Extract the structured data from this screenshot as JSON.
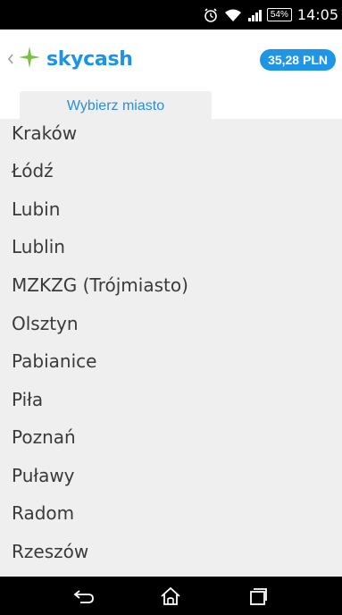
{
  "status_bar": {
    "battery": "54%",
    "time": "14:05",
    "icons": [
      "alarm-icon",
      "wifi-icon",
      "signal-icon",
      "battery-icon"
    ]
  },
  "header": {
    "logo_text": "skycash",
    "balance": "35,28 PLN",
    "accent_color": "#1e95e6",
    "logo_green": "#7ac142"
  },
  "tab": {
    "label": "Wybierz miasto"
  },
  "cities": [
    "Kraków",
    "Łódź",
    "Lubin",
    "Lublin",
    "MZKZG (Trójmiasto)",
    "Olsztyn",
    "Pabianice",
    "Piła",
    "Poznań",
    "Puławy",
    "Radom",
    "Rzeszów"
  ],
  "nav_bar": {
    "buttons": [
      "back-icon",
      "home-icon",
      "recent-apps-icon"
    ]
  }
}
